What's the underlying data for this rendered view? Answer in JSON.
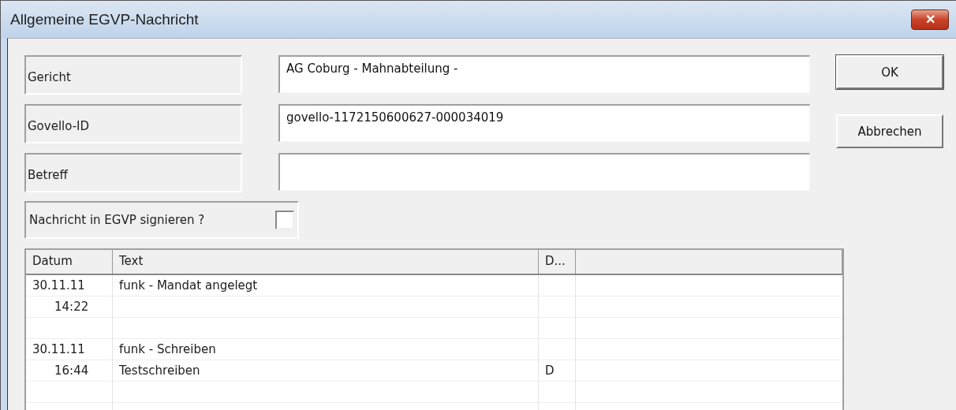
{
  "window": {
    "title": "Allgemeine EGVP-Nachricht",
    "close_glyph": "✕"
  },
  "fields": [
    {
      "label": "Gericht",
      "value": "AG Coburg - Mahnabteilung -"
    },
    {
      "label": "Govello-ID",
      "value": "govello-1172150600627-000034019"
    },
    {
      "label": "Betreff"
    }
  ],
  "sign": {
    "label": "Nachricht in EGVP signieren ?",
    "checked": false
  },
  "buttons": [
    {
      "label": "OK",
      "default": true
    },
    {
      "label": "Abbrechen",
      "default": false
    }
  ],
  "table": {
    "columns": [
      "Datum",
      "Text",
      "D..."
    ],
    "rows": [
      {
        "kind": "line",
        "datum": "30.11.11",
        "text": "funk - Mandat angelegt"
      },
      {
        "kind": "line",
        "datum": "14:22"
      },
      {
        "kind": "blank"
      },
      {
        "kind": "line",
        "datum": "30.11.11",
        "text": "funk - Schreiben"
      },
      {
        "kind": "line",
        "datum": "16:44",
        "text": "Testschreiben",
        "d": "D"
      },
      {
        "kind": "blank"
      },
      {
        "kind": "blank"
      }
    ]
  }
}
